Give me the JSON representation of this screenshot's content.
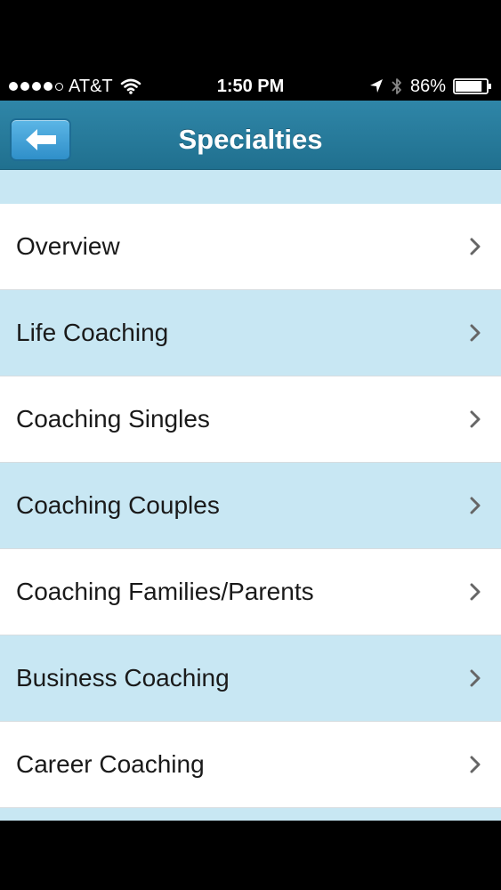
{
  "status_bar": {
    "carrier": "AT&T",
    "time": "1:50 PM",
    "battery_percent": "86%",
    "battery_level": 0.86,
    "signal_bars": 4,
    "signal_total": 5
  },
  "nav": {
    "title": "Specialties",
    "back_icon": "left-arrow-icon"
  },
  "colors": {
    "nav_bar": "#2a7fa0",
    "back_button": "#4aa8dc",
    "row_blue": "#c8e7f3",
    "row_white": "#ffffff"
  },
  "list": {
    "items": [
      {
        "label": "Overview"
      },
      {
        "label": "Life Coaching"
      },
      {
        "label": "Coaching Singles"
      },
      {
        "label": "Coaching Couples"
      },
      {
        "label": "Coaching Families/Parents"
      },
      {
        "label": "Business Coaching"
      },
      {
        "label": "Career Coaching"
      }
    ]
  }
}
